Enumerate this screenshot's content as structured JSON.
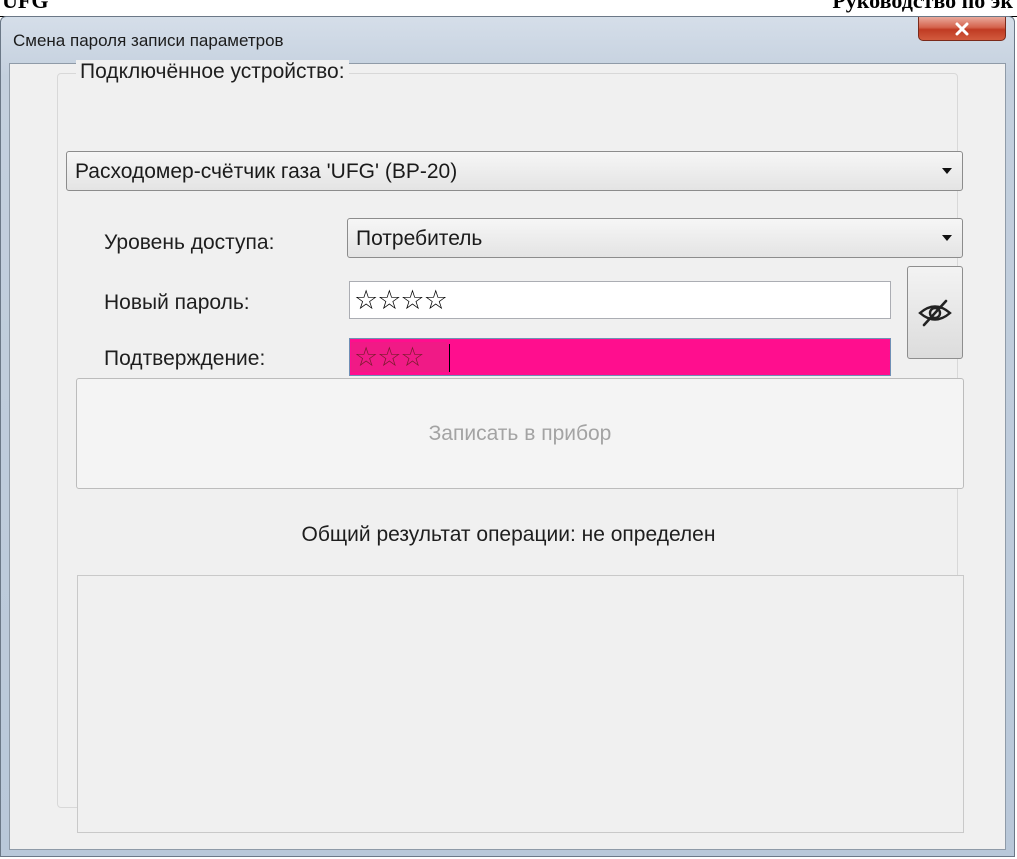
{
  "document_header": {
    "left_text": "UFG",
    "right_text": "Руководство по эк"
  },
  "window": {
    "title": "Смена пароля записи параметров",
    "close_glyph": "x"
  },
  "device_group": {
    "title": "Подключённое устройство:",
    "device_selected": "Расходомер-счётчик газа 'UFG' (ВР-20)"
  },
  "access": {
    "label": "Уровень доступа:",
    "selected": "Потребитель"
  },
  "new_password": {
    "label": "Новый пароль:",
    "value": "☆☆☆☆"
  },
  "confirm_password": {
    "label": "Подтверждение:",
    "value": "☆☆☆",
    "highlight_color": "#ff0e8e"
  },
  "toggle_visibility": {
    "icon": "eye-slash-icon"
  },
  "write_button": {
    "label": "Записать в прибор",
    "enabled": false
  },
  "result": {
    "text": "Общий результат операции: не определен"
  },
  "colors": {
    "mismatch_field": "#ff0e8e",
    "close_button": "#c03b23",
    "disabled_text": "#a3a3a3"
  }
}
